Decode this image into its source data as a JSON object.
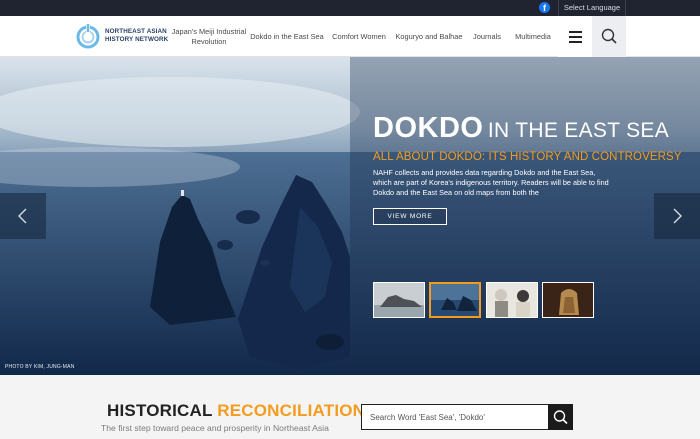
{
  "topbar": {
    "facebook_icon": "f",
    "language_label": "Select Language"
  },
  "header": {
    "logo_line1": "NORTHEAST ASIAN",
    "logo_line2": "HISTORY NETWORK",
    "nav": [
      {
        "label": "Japan's Meiji Industrial Revolution"
      },
      {
        "label": "Dokdo in the East Sea"
      },
      {
        "label": "Comfort Women"
      },
      {
        "label": "Koguryo and Balhae"
      },
      {
        "label": "Journals"
      },
      {
        "label": "Multimedia"
      }
    ]
  },
  "hero": {
    "title_big": "DOKDO",
    "title_small": "IN THE EAST SEA",
    "subtitle": "ALL ABOUT DOKDO: ITS HISTORY AND CONTROVERSY",
    "body": "NAHF collects and provides data regarding Dokdo and the East Sea, which are part of Korea's indigenous territory. Readers will be able to find Dokdo and the East Sea on old maps from both the",
    "button": "VIEW MORE",
    "photo_credit": "PHOTO BY KIM, JUNG-MAN",
    "active_thumbnail": 2
  },
  "reconciliation": {
    "title_dark": "HISTORICAL",
    "title_accent": "RECONCILIATIONS",
    "subtitle": "The first step toward peace and prosperity in Northeast Asia",
    "search_placeholder": "Search Word 'East Sea', 'Dokdo'"
  },
  "colors": {
    "accent": "#f39c1f",
    "topbar": "#1f2430",
    "hero_blue": "#1d3552"
  }
}
